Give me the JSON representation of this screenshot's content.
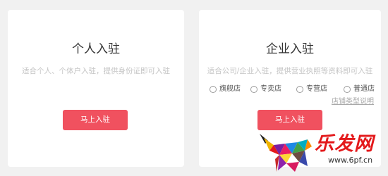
{
  "colors": {
    "background": "#f1f1f1",
    "card": "#ffffff",
    "accent": "#f0515f",
    "watermark_red": "#e3181a"
  },
  "personal": {
    "title": "个人入驻",
    "description": "适合个人、个体户入驻，提供身份证即可入驻",
    "button_label": "马上入驻"
  },
  "enterprise": {
    "title": "企业入驻",
    "description": "适合公司/企业入驻，提供营业执照等资料即可入驻",
    "store_types": [
      {
        "label": "旗舰店",
        "selected": false
      },
      {
        "label": "专卖店",
        "selected": false
      },
      {
        "label": "专营店",
        "selected": false
      },
      {
        "label": "普通店",
        "selected": false
      }
    ],
    "store_types_link": "店铺类型说明",
    "button_label": "马上入驻"
  },
  "watermark": {
    "brand": "乐发网",
    "url": "www.6pf.cn",
    "icon": "bull-logo-icon"
  }
}
